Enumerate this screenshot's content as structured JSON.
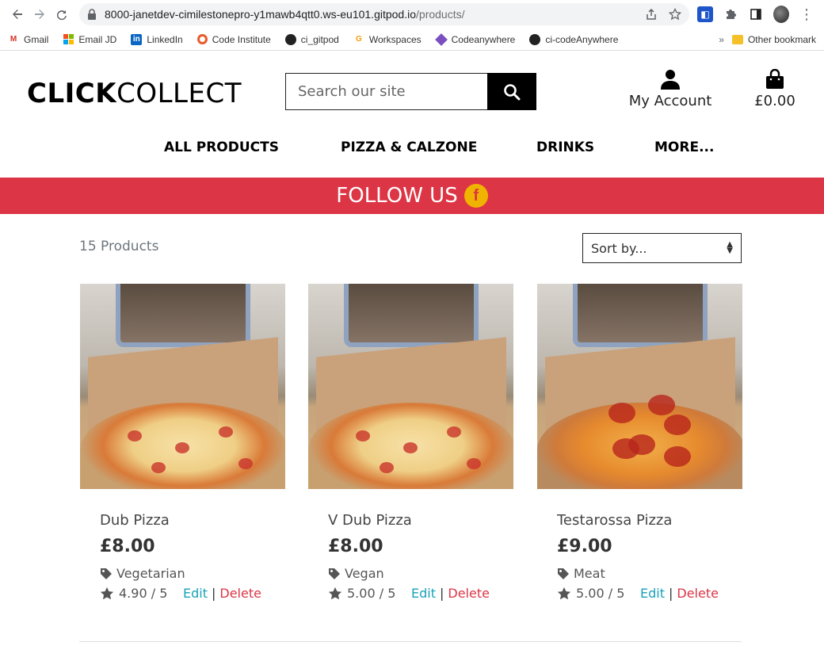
{
  "browser": {
    "url_host": "8000-janetdev-cimilestonepro-y1mawb4qtt0.ws-eu101.gitpod.io",
    "url_path": "/products/",
    "bookmarks": [
      "Gmail",
      "Email JD",
      "LinkedIn",
      "Code Institute",
      "ci_gitpod",
      "Workspaces",
      "Codeanywhere",
      "ci-codeAnywhere"
    ],
    "more_label": "»",
    "other_bookmarks": "Other bookmark"
  },
  "header": {
    "logo_bold": "CLICK",
    "logo_rest": "COLLECT",
    "search_placeholder": "Search our site",
    "account_label": "My Account",
    "bag_total": "£0.00"
  },
  "nav": [
    "ALL PRODUCTS",
    "PIZZA & CALZONE",
    "DRINKS",
    "MORE..."
  ],
  "banner": {
    "text": "FOLLOW US",
    "fb_letter": "f",
    "color": "#dc3545"
  },
  "listing": {
    "count": "15 Products",
    "sort_label": "Sort by..."
  },
  "products": [
    {
      "name": "Dub Pizza",
      "price": "£8.00",
      "tag": "Vegetarian",
      "rating": "4.90 / 5",
      "edit": "Edit",
      "delete": "Delete"
    },
    {
      "name": "V Dub Pizza",
      "price": "£8.00",
      "tag": "Vegan",
      "rating": "5.00 / 5",
      "edit": "Edit",
      "delete": "Delete"
    },
    {
      "name": "Testarossa Pizza",
      "price": "£9.00",
      "tag": "Meat",
      "rating": "5.00 / 5",
      "edit": "Edit",
      "delete": "Delete"
    }
  ],
  "separator": "|"
}
